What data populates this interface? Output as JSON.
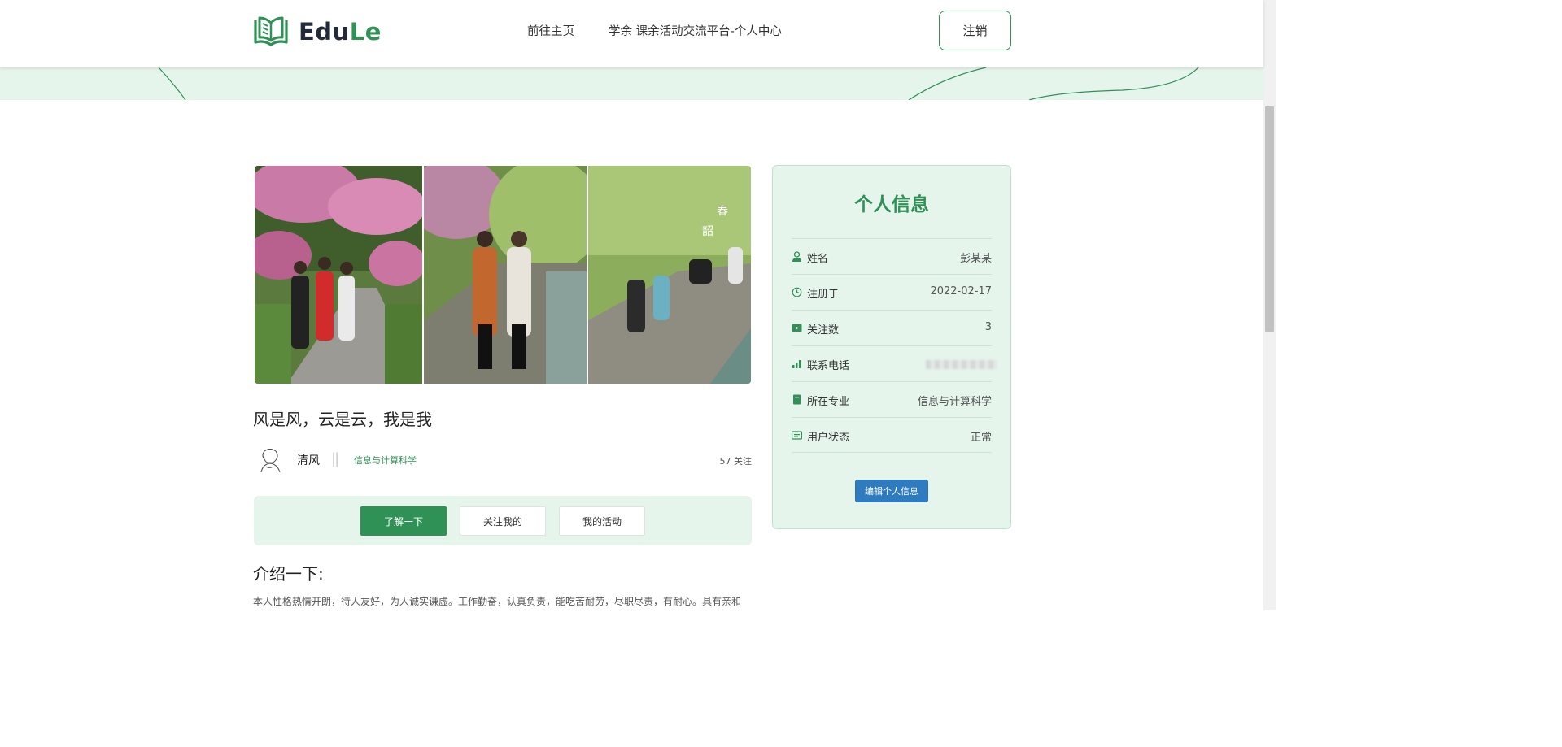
{
  "header": {
    "logo_part1": "Edu",
    "logo_part2": "Le",
    "nav_home": "前往主页",
    "nav_center": "学余 课余活动交流平台-个人中心",
    "logout_label": "注销"
  },
  "post": {
    "title": "风是风，云是云，我是我",
    "author_name": "清风",
    "separator": "||",
    "author_major": "信息与计算科学",
    "follow_count": "57 关注"
  },
  "tabs": [
    {
      "label": "了解一下",
      "active": true
    },
    {
      "label": "关注我的",
      "active": false
    },
    {
      "label": "我的活动",
      "active": false
    }
  ],
  "intro": {
    "title": "介绍一下:",
    "text": "本人性格热情开朗，待人友好，为人诚实谦虚。工作勤奋，认真负责，能吃苦耐劳，尽职尽责，有耐心。具有亲和"
  },
  "info_card": {
    "title": "个人信息",
    "rows": [
      {
        "icon": "user-icon",
        "label": "姓名",
        "value": "彭某某"
      },
      {
        "icon": "clock-icon",
        "label": "注册于",
        "value": "2022-02-17"
      },
      {
        "icon": "video-icon",
        "label": "关注数",
        "value": "3"
      },
      {
        "icon": "signal-icon",
        "label": "联系电话",
        "value": ""
      },
      {
        "icon": "book-icon",
        "label": "所在专业",
        "value": "信息与计算科学"
      },
      {
        "icon": "status-icon",
        "label": "用户状态",
        "value": "正常"
      }
    ],
    "edit_label": "编辑个人信息"
  },
  "colors": {
    "brand_green": "#2f9155",
    "light_green": "#e6f5ec",
    "edit_blue": "#2f7bbf"
  }
}
